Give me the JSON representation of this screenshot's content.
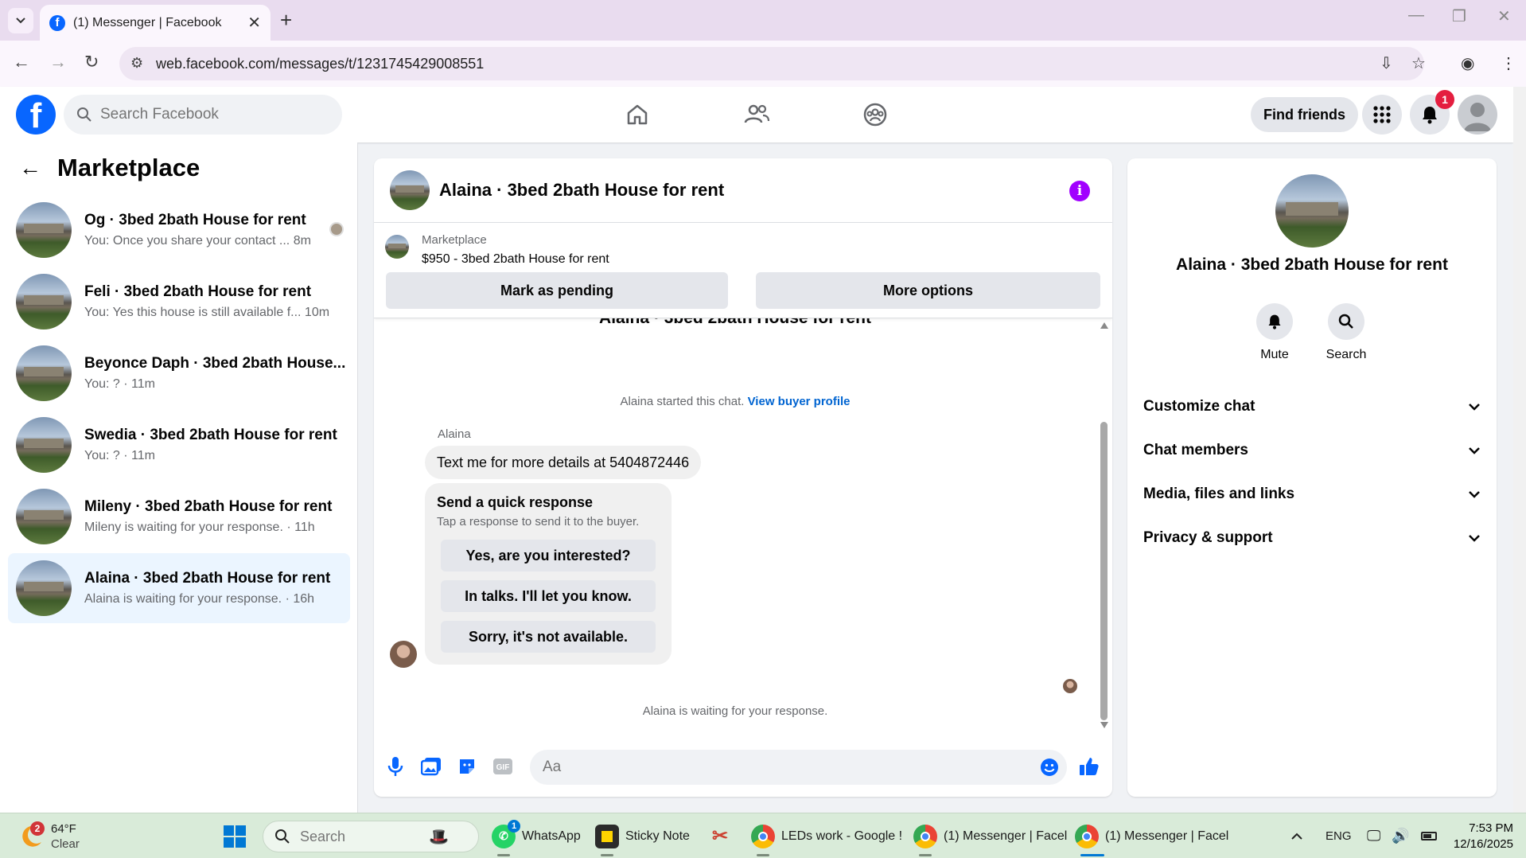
{
  "browser": {
    "tab_title": "(1) Messenger | Facebook",
    "url": "web.facebook.com/messages/t/1231745429008551"
  },
  "header": {
    "search_placeholder": "Search Facebook",
    "find_friends": "Find friends",
    "notification_count": "1"
  },
  "left_panel": {
    "title": "Marketplace",
    "conversations": [
      {
        "name": "Og · 3bed 2bath House for rent",
        "preview": "You: Once you share your contact ...",
        "time": "8m"
      },
      {
        "name": "Feli · 3bed 2bath House for rent",
        "preview": "You: Yes this house is still available f...",
        "time": "10m"
      },
      {
        "name": "Beyonce Daph · 3bed 2bath House...",
        "preview": "You: ?",
        "time": "11m"
      },
      {
        "name": "Swedia · 3bed 2bath House for rent",
        "preview": "You: ?",
        "time": "11m"
      },
      {
        "name": "Mileny · 3bed 2bath House for rent",
        "preview": "Mileny is waiting for your response.",
        "time": "11h"
      },
      {
        "name": "Alaina · 3bed 2bath House for rent",
        "preview": "Alaina is waiting for your response.",
        "time": "16h"
      }
    ]
  },
  "chat": {
    "title": "Alaina · 3bed 2bath House for rent",
    "listing_source": "Marketplace",
    "listing_price": "$950 - 3bed 2bath House for rent",
    "mark_pending": "Mark as pending",
    "more_options": "More options",
    "started_text": "Alaina started this chat.",
    "view_profile": "View buyer profile",
    "sender": "Alaina",
    "message": "Text me for more details at 5404872446",
    "quick_title": "Send a quick response",
    "quick_sub": "Tap a response to send it to the buyer.",
    "quick_options": [
      "Yes, are you interested?",
      "In talks. I'll let you know.",
      "Sorry, it's not available."
    ],
    "waiting": "Alaina is waiting for your response.",
    "composer_placeholder": "Aa"
  },
  "right_panel": {
    "name": "Alaina · 3bed 2bath House for rent",
    "mute": "Mute",
    "search": "Search",
    "sections": [
      "Customize chat",
      "Chat members",
      "Media, files and links",
      "Privacy & support"
    ]
  },
  "taskbar": {
    "temp": "64°F",
    "condition": "Clear",
    "weather_badge": "2",
    "search": "Search",
    "apps": [
      {
        "label": "WhatsApp",
        "badge": "1"
      },
      {
        "label": "Sticky Note"
      },
      {
        "label": ""
      },
      {
        "label": "LEDs work - Google !"
      },
      {
        "label": "(1) Messenger | Facel"
      },
      {
        "label": "(1) Messenger | Facel"
      }
    ],
    "lang": "ENG",
    "time": "7:53 PM",
    "date": "12/16/2025"
  },
  "colors": {
    "facebook_blue": "#0866ff",
    "info_purple": "#a100ff",
    "active_row": "#ebf5ff",
    "link_blue": "#0064d1"
  }
}
